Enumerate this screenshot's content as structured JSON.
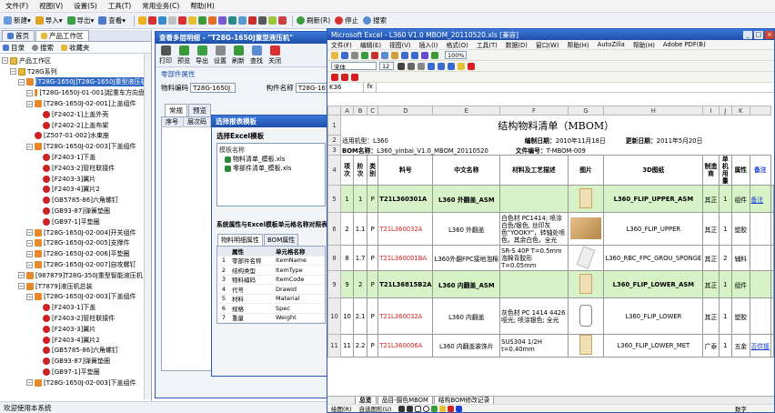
{
  "app": {
    "menu": [
      "文件(F)",
      "视图(V)",
      "设置(S)",
      "工具(T)",
      "常用业务(C)",
      "帮助(H)"
    ],
    "toolbar": {
      "new_label": "新建",
      "import_label": "导入",
      "export_label": "导出",
      "view_label": "查看",
      "refresh_label": "刷新(R)",
      "stop_label": "停止",
      "search_label": "搜索"
    },
    "status_text": "欢迎使用本系统"
  },
  "left": {
    "tabs": [
      "首页",
      "产品工作区"
    ],
    "subtabs": [
      "目录",
      "搜索",
      "收藏夹"
    ],
    "tree": [
      {
        "level": 0,
        "label": "产品工作区",
        "icon": "folder"
      },
      {
        "level": 1,
        "label": "T28G系列",
        "icon": "folder"
      },
      {
        "level": 2,
        "label": "[T28G-1650J]T28G-1650J重型液压机",
        "icon": "orange",
        "selected": true
      },
      {
        "level": 3,
        "label": "[T28G-1650J-01-001]起重车方向盘盒",
        "icon": "orange"
      },
      {
        "level": 3,
        "label": "[T28G-1650J-02-001]上盖组件",
        "icon": "orange"
      },
      {
        "level": 4,
        "label": "[F2402-1]上盖外壳",
        "icon": "red"
      },
      {
        "level": 4,
        "label": "[F2402-2]上盖布架",
        "icon": "red"
      },
      {
        "level": 3,
        "label": "[Z507-01-002]水束座",
        "icon": "red"
      },
      {
        "level": 3,
        "label": "[T28G-1650J-02-003]下盖组件",
        "icon": "orange"
      },
      {
        "level": 4,
        "label": "[F2403-1]下盖",
        "icon": "red"
      },
      {
        "level": 4,
        "label": "[F2403-2]管柱联接件",
        "icon": "red"
      },
      {
        "level": 4,
        "label": "[F2403-3]翼片",
        "icon": "red"
      },
      {
        "level": 4,
        "label": "[F2403-4]翼片2",
        "icon": "red"
      },
      {
        "level": 4,
        "label": "[GB5785-86]六角螺钉",
        "icon": "red"
      },
      {
        "level": 4,
        "label": "[GB93-87]弹簧垫圈",
        "icon": "red"
      },
      {
        "level": 4,
        "label": "[GB97-1]平垫圈",
        "icon": "red"
      },
      {
        "level": 3,
        "label": "[T28G-1650J-02-004]开关组件",
        "icon": "orange"
      },
      {
        "level": 3,
        "label": "[T28G-1650J-02-005]支撑件",
        "icon": "orange"
      },
      {
        "level": 3,
        "label": "[T28G-1650J-02-006]平垫圈",
        "icon": "orange"
      },
      {
        "level": 3,
        "label": "[T28G-1650J-02-007]自攻螺钉",
        "icon": "orange"
      },
      {
        "level": 2,
        "label": "[987879]T28G-350J重型智能液压机",
        "icon": "orange"
      },
      {
        "level": 2,
        "label": "[T7879]液压机总装",
        "icon": "orange"
      },
      {
        "level": 3,
        "label": "[T28G-1650J-02-003]下盖组件",
        "icon": "orange"
      },
      {
        "level": 4,
        "label": "[F2403-1]下盖",
        "icon": "red"
      },
      {
        "level": 4,
        "label": "[F2403-2]管柱联接件",
        "icon": "red"
      },
      {
        "level": 4,
        "label": "[F2403-3]翼片",
        "icon": "red"
      },
      {
        "level": 4,
        "label": "[F2403-4]翼片2",
        "icon": "red"
      },
      {
        "level": 4,
        "label": "[GB5785-86]六角螺钉",
        "icon": "red"
      },
      {
        "level": 4,
        "label": "[GB93-87]弹簧垫圈",
        "icon": "red"
      },
      {
        "level": 4,
        "label": "[GB97-1]平垫圈",
        "icon": "red"
      },
      {
        "level": 3,
        "label": "[T28G-1650J-02-003]下盖组件",
        "icon": "orange"
      }
    ]
  },
  "mid": {
    "title": "查看多层明细 - \"T28G-1650J重型液压机\"",
    "toolbar": [
      "打印",
      "预览",
      "导出",
      "设置",
      "刷新",
      "查找",
      "关闭"
    ],
    "section_label": "零部件属性",
    "code_label": "物料编码",
    "code_value": "T28G-1650J",
    "name_label": "构件名称",
    "name_value": "T28G-1650J重型",
    "tabs": [
      "常规",
      "预览"
    ],
    "grid_headers": [
      "序号",
      "层次码"
    ]
  },
  "dialog": {
    "title": "选择报表模板",
    "section1": "选择Excel模板",
    "list_header": "模板名称",
    "templates": [
      "物料清单_模板.xls",
      "零部件清单_模板.xls"
    ],
    "section2": "系统属性与Excel模板单元格名称对照表(",
    "tabs": [
      "物料明细属性",
      "BOM属性"
    ],
    "headers": [
      "",
      "属性",
      "单元格名称"
    ],
    "rows": [
      [
        "1",
        "零部件名称",
        "ItemName"
      ],
      [
        "2",
        "结构类型",
        "ItemType"
      ],
      [
        "3",
        "物料编码",
        "ItemCode"
      ],
      [
        "4",
        "代号",
        "DrawId"
      ],
      [
        "5",
        "材料",
        "Material"
      ],
      [
        "6",
        "规格",
        "Spec"
      ],
      [
        "7",
        "重量",
        "Weight"
      ]
    ]
  },
  "excel": {
    "title": "Microsoft Excel - L360 V1.0 MBOM_20110520.xls [兼容]",
    "menu": [
      "文件(F)",
      "编辑(E)",
      "视图(V)",
      "插入(I)",
      "格式(O)",
      "工具(T)",
      "数据(D)",
      "窗口(W)",
      "帮助(H)",
      "AutoZilla",
      "帮助(H)",
      "Adobe PDF(B)"
    ],
    "zoom": "100%",
    "name_box": "K36",
    "font": "宋体",
    "font_size": "12",
    "col_letters": [
      "A",
      "B",
      "C",
      "D",
      "E",
      "F",
      "G",
      "H",
      "I",
      "J",
      "K"
    ],
    "sheet_title": "结构物料清单（MBOM）",
    "info": {
      "model_label": "适用机型：",
      "model": "L360",
      "date_label": "编制日期：",
      "date": "2010年11月18日",
      "update_label": "更新日期：",
      "update": "2011年5月20日",
      "bom_label": "BOM名称：",
      "bom": "L360_yinbai_V1.0_MBOM_20110520",
      "doc_label": "文件编号：",
      "doc": "T-MBOM-009"
    },
    "headers": [
      "项次",
      "阶次",
      "类别",
      "料号",
      "中文名称",
      "材料及工艺描述",
      "图片",
      "3D图纸",
      "制造商",
      "单机用量",
      "属性",
      "备注"
    ],
    "rows": [
      {
        "rn": "5",
        "green": true,
        "cells": [
          "1",
          "1",
          "P",
          "T21L360301A",
          "L360 外翻盖_ASM",
          "",
          "thumb",
          "L360_FLIP_UPPER_ASM",
          "其正",
          "1",
          "组件",
          "备注"
        ]
      },
      {
        "rn": "6",
        "green": false,
        "cells": [
          "2",
          "1.1",
          "P",
          "T21L360032A",
          "L360 外翻盖",
          "白色材 PC1414; 喷涂白色/银色, 丝印灰色\"YOOKY\"，转轴处喷色，其余白色，全光",
          "thumb2",
          "L360_FLIP_UPPER",
          "其正",
          "1",
          "塑胶",
          ""
        ]
      },
      {
        "rn": "8",
        "green": false,
        "cells": [
          "8",
          "1.7",
          "P",
          "T21L360001BA",
          "L360外翻FPC接地泡棉",
          "SR-S 40P T=0.5mm 泡棉背胶形T=0.05mm",
          "thumb3",
          "L360_RBC_FPC_GROU_SPONGE",
          "其正",
          "2",
          "辅料",
          ""
        ]
      },
      {
        "rn": "9",
        "green": true,
        "cells": [
          "9",
          "2",
          "P",
          "T21L36815B2A",
          "L360 内翻盖_ASM",
          "",
          "thumb",
          "L360_FLIP_LOWER_ASM",
          "其正",
          "1",
          "组件",
          ""
        ]
      },
      {
        "rn": "10",
        "green": false,
        "cells": [
          "10",
          "2.1",
          "P",
          "T21L360032A",
          "L360 内翻盖",
          "灰色材 PC 1414 4426哑光; 喷涂银色; 全光",
          "thumb4",
          "L360_FLIP_LOWER",
          "其正",
          "1",
          "塑胶",
          ""
        ]
      },
      {
        "rn": "11",
        "green": false,
        "cells": [
          "11",
          "2.2",
          "P",
          "T21L360006A",
          "L360 内翻盖装饰片",
          "SUS304 1/2H t=0.40mm",
          "thumb",
          "L360_FLIP_LOWER_MET",
          "广泰",
          "1",
          "五金",
          "否供镀"
        ]
      }
    ],
    "sheet_tabs": [
      "总览",
      "品目-摄色MBOM",
      "结构BOM修改记录"
    ],
    "draw_label": "绘图(R)",
    "autoshape_label": "自选图形(U)",
    "status_right": "数字"
  }
}
